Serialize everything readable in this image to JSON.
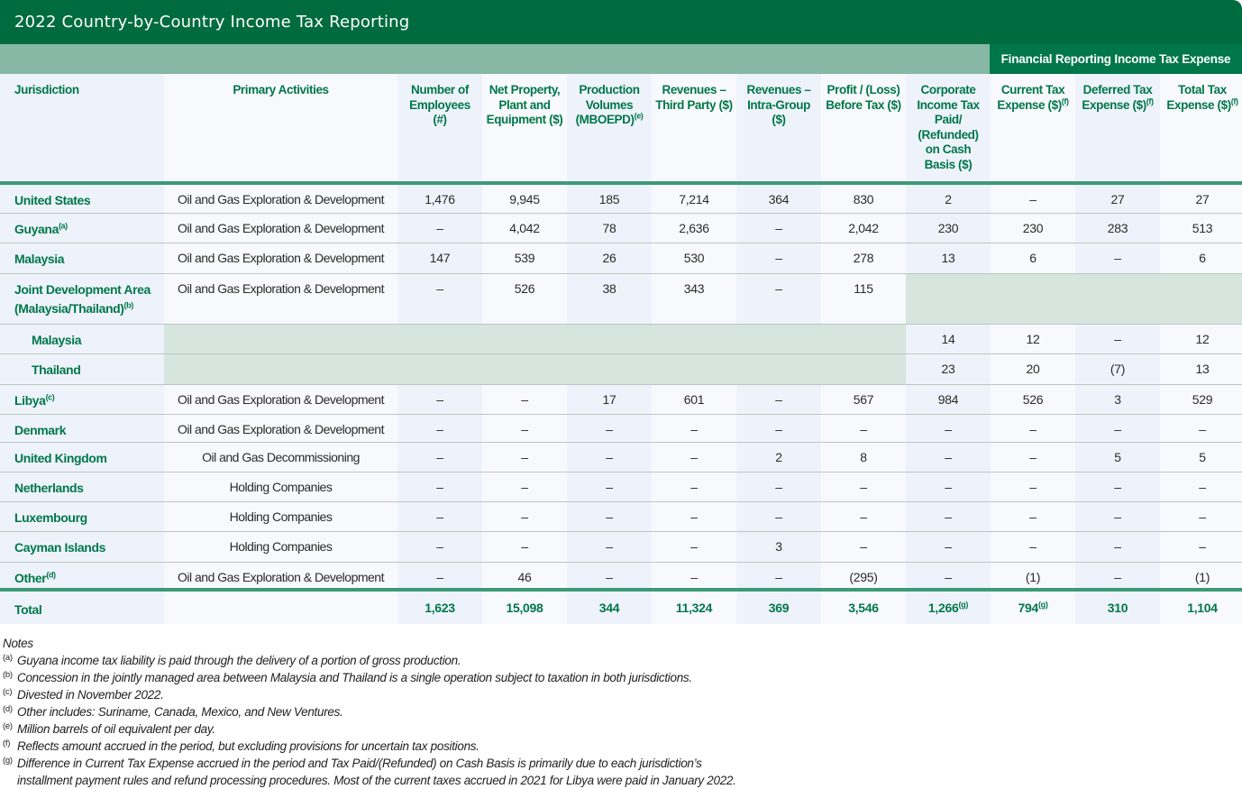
{
  "title": "2022 Country-by-Country Income Tax Reporting",
  "band_label": "Financial Reporting Income Tax Expense",
  "columns": [
    {
      "label": "Jurisdiction"
    },
    {
      "label": "Primary Activities"
    },
    {
      "label": "Number of Employees (#)"
    },
    {
      "label": "Net Property, Plant and Equipment ($)"
    },
    {
      "label": "Production Volumes (MBOEPD)",
      "note": "(e)"
    },
    {
      "label": "Revenues – Third Party ($)"
    },
    {
      "label": "Revenues – Intra-Group ($)"
    },
    {
      "label": "Profit / (Loss) Before Tax ($)"
    },
    {
      "label": "Corporate Income Tax Paid/ (Refunded) on Cash Basis ($)"
    },
    {
      "label": "Current Tax Expense ($)",
      "note": "(f)"
    },
    {
      "label": "Deferred Tax Expense ($)",
      "note": "(f)"
    },
    {
      "label": "Total Tax Expense ($)",
      "note": "(f)"
    }
  ],
  "rows": [
    {
      "jurisdiction": "United States",
      "note": "",
      "activity": "Oil and Gas Exploration & Development",
      "employees": "1,476",
      "ppe": "9,945",
      "production": "185",
      "rev_third": "7,214",
      "rev_intra": "364",
      "profit": "830",
      "tax_paid": "2",
      "current": "–",
      "deferred": "27",
      "total": "27"
    },
    {
      "jurisdiction": "Guyana",
      "note": "(a)",
      "activity": "Oil and Gas Exploration & Development",
      "employees": "–",
      "ppe": "4,042",
      "production": "78",
      "rev_third": "2,636",
      "rev_intra": "–",
      "profit": "2,042",
      "tax_paid": "230",
      "current": "230",
      "deferred": "283",
      "total": "513"
    },
    {
      "jurisdiction": "Malaysia",
      "note": "",
      "activity": "Oil and Gas Exploration & Development",
      "employees": "147",
      "ppe": "539",
      "production": "26",
      "rev_third": "530",
      "rev_intra": "–",
      "profit": "278",
      "tax_paid": "13",
      "current": "6",
      "deferred": "–",
      "total": "6"
    },
    {
      "jurisdiction": "Joint Development Area (Malaysia/Thailand)",
      "note": "(b)",
      "activity": "Oil and Gas Exploration & Development",
      "employees": "–",
      "ppe": "526",
      "production": "38",
      "rev_third": "343",
      "rev_intra": "–",
      "profit": "115"
    },
    {
      "jurisdiction": "Malaysia",
      "tax_paid": "14",
      "current": "12",
      "deferred": "–",
      "total": "12"
    },
    {
      "jurisdiction": "Thailand",
      "tax_paid": "23",
      "current": "20",
      "deferred": "(7)",
      "total": "13"
    },
    {
      "jurisdiction": "Libya",
      "note": "(c)",
      "activity": "Oil and Gas Exploration & Development",
      "employees": "–",
      "ppe": "–",
      "production": "17",
      "rev_third": "601",
      "rev_intra": "–",
      "profit": "567",
      "tax_paid": "984",
      "current": "526",
      "deferred": "3",
      "total": "529"
    },
    {
      "jurisdiction": "Denmark",
      "note": "",
      "activity": "Oil and Gas Exploration & Development",
      "employees": "–",
      "ppe": "–",
      "production": "–",
      "rev_third": "–",
      "rev_intra": "–",
      "profit": "–",
      "tax_paid": "–",
      "current": "–",
      "deferred": "–",
      "total": "–"
    },
    {
      "jurisdiction": "United Kingdom",
      "note": "",
      "activity": "Oil and Gas Decommissioning",
      "employees": "–",
      "ppe": "–",
      "production": "–",
      "rev_third": "–",
      "rev_intra": "2",
      "profit": "8",
      "tax_paid": "–",
      "current": "–",
      "deferred": "5",
      "total": "5"
    },
    {
      "jurisdiction": "Netherlands",
      "note": "",
      "activity": "Holding Companies",
      "employees": "–",
      "ppe": "–",
      "production": "–",
      "rev_third": "–",
      "rev_intra": "–",
      "profit": "–",
      "tax_paid": "–",
      "current": "–",
      "deferred": "–",
      "total": "–"
    },
    {
      "jurisdiction": "Luxembourg",
      "note": "",
      "activity": "Holding Companies",
      "employees": "–",
      "ppe": "–",
      "production": "–",
      "rev_third": "–",
      "rev_intra": "–",
      "profit": "–",
      "tax_paid": "–",
      "current": "–",
      "deferred": "–",
      "total": "–"
    },
    {
      "jurisdiction": "Cayman Islands",
      "note": "",
      "activity": "Holding Companies",
      "employees": "–",
      "ppe": "–",
      "production": "–",
      "rev_third": "–",
      "rev_intra": "3",
      "profit": "–",
      "tax_paid": "–",
      "current": "–",
      "deferred": "–",
      "total": "–"
    },
    {
      "jurisdiction": "Other",
      "note": "(d)",
      "activity": "Oil and Gas Exploration & Development",
      "employees": "–",
      "ppe": "46",
      "production": "–",
      "rev_third": "–",
      "rev_intra": "–",
      "profit": "(295)",
      "tax_paid": "–",
      "current": "(1)",
      "deferred": "–",
      "total": "(1)"
    }
  ],
  "total": {
    "label": "Total",
    "employees": "1,623",
    "ppe": "15,098",
    "production": "344",
    "rev_third": "11,324",
    "rev_intra": "369",
    "profit": "3,546",
    "tax_paid": "1,266",
    "tax_paid_note": "(g)",
    "current": "794",
    "current_note": "(g)",
    "deferred": "310",
    "total": "1,104"
  },
  "notes": {
    "heading": "Notes",
    "items": [
      {
        "marker": "(a)",
        "text": "Guyana income tax liability is paid through the delivery of a portion of gross production."
      },
      {
        "marker": "(b)",
        "text": "Concession in the jointly managed area between Malaysia and Thailand is a single operation subject to taxation in both jurisdictions."
      },
      {
        "marker": "(c)",
        "text": "Divested in November 2022."
      },
      {
        "marker": "(d)",
        "text": "Other includes: Suriname, Canada, Mexico, and New Ventures."
      },
      {
        "marker": "(e)",
        "text": "Million barrels of oil equivalent per day."
      },
      {
        "marker": "(f)",
        "text": "Reflects amount accrued in the period, but excluding provisions for uncertain tax positions."
      },
      {
        "marker": "(g)",
        "text": "Difference in Current Tax Expense accrued in the period and Tax Paid/(Refunded) on Cash Basis is primarily due to each jurisdiction’s",
        "text2": "installment payment rules and refund processing procedures. Most of the current taxes accrued in 2021 for Libya were paid in January 2022."
      }
    ]
  }
}
